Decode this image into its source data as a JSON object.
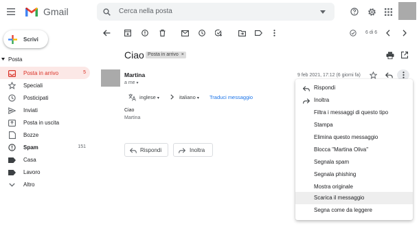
{
  "header": {
    "app_name": "Gmail",
    "search_placeholder": "Cerca nella posta"
  },
  "sidebar": {
    "compose_label": "Scrivi",
    "folders_header": "Posta",
    "items": [
      {
        "label": "Posta in arrivo",
        "count": "5",
        "icon": "inbox-icon",
        "active": true
      },
      {
        "label": "Speciali",
        "count": "",
        "icon": "star-icon"
      },
      {
        "label": "Posticipati",
        "count": "",
        "icon": "clock-icon"
      },
      {
        "label": "Inviati",
        "count": "",
        "icon": "send-icon"
      },
      {
        "label": "Posta in uscita",
        "count": "",
        "icon": "outbox-icon"
      },
      {
        "label": "Bozze",
        "count": "",
        "icon": "draft-icon"
      },
      {
        "label": "Spam",
        "count": "151",
        "icon": "spam-icon",
        "bold": true
      },
      {
        "label": "Casa",
        "count": "",
        "icon": "label-icon"
      },
      {
        "label": "Lavoro",
        "count": "",
        "icon": "label-icon"
      },
      {
        "label": "Altro",
        "count": "",
        "icon": "chevron-down-icon"
      }
    ]
  },
  "toolbar": {
    "pager": "6 di 6"
  },
  "message": {
    "subject": "Ciao",
    "label_chip": "Posta in arrivo",
    "sender": "Martina",
    "to": "a me",
    "date": "9 feb 2021, 17:12 (6 giorni fa)",
    "translate": {
      "from_lang": "inglese",
      "to_lang": "italiano",
      "link": "Traduci messaggio"
    },
    "body_greeting": "Ciao",
    "body_signature": "Martina",
    "reply_label": "Rispondi",
    "forward_label": "Inoltra"
  },
  "menu": {
    "items": [
      {
        "label": "Rispondi",
        "icon": "reply-icon"
      },
      {
        "label": "Inoltra",
        "icon": "forward-icon"
      },
      {
        "label": "Filtra i messaggi di questo tipo"
      },
      {
        "label": "Stampa"
      },
      {
        "label": "Elimina questo messaggio"
      },
      {
        "label": "Blocca \"Martina Oliva\""
      },
      {
        "label": "Segnala spam"
      },
      {
        "label": "Segnala phishing"
      },
      {
        "label": "Mostra originale"
      },
      {
        "label": "Scarica il messaggio",
        "highlighted": true
      },
      {
        "label": "Segna come da leggere"
      }
    ]
  },
  "colors": {
    "accent_red": "#d93025",
    "active_bg": "#fce8e6",
    "link_blue": "#1a73e8",
    "menu_highlight": "#eeeeee"
  }
}
